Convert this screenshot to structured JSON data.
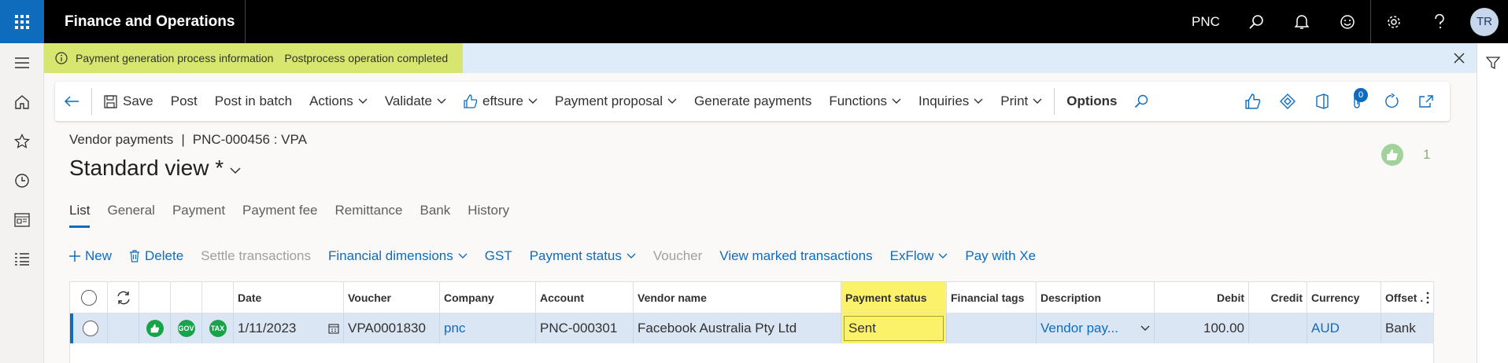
{
  "app": {
    "title": "Finance and Operations",
    "company": "PNC",
    "avatar_initials": "TR"
  },
  "infobar": {
    "label": "Payment generation process information",
    "message": "Postprocess operation completed"
  },
  "actions": {
    "save": "Save",
    "post": "Post",
    "post_in_batch": "Post in batch",
    "actions": "Actions",
    "validate": "Validate",
    "eftsure": "eftsure",
    "payment_proposal": "Payment proposal",
    "generate_payments": "Generate payments",
    "functions": "Functions",
    "inquiries": "Inquiries",
    "print": "Print",
    "options": "Options",
    "attachments_count": "0"
  },
  "page": {
    "breadcrumb_module": "Vendor payments",
    "breadcrumb_sep": "|",
    "breadcrumb_record": "PNC-000456 : VPA",
    "view_title": "Standard view *",
    "likes_count": "1"
  },
  "tabs": [
    "List",
    "General",
    "Payment",
    "Payment fee",
    "Remittance",
    "Bank",
    "History"
  ],
  "gridbar": {
    "new": "New",
    "delete": "Delete",
    "settle": "Settle transactions",
    "financial_dimensions": "Financial dimensions",
    "gst": "GST",
    "payment_status": "Payment status",
    "voucher": "Voucher",
    "view_marked": "View marked transactions",
    "exflow": "ExFlow",
    "pay_with_xe": "Pay with Xe"
  },
  "grid": {
    "columns": {
      "date": "Date",
      "voucher": "Voucher",
      "company": "Company",
      "account": "Account",
      "vendor_name": "Vendor name",
      "payment_status": "Payment status",
      "financial_tags": "Financial tags",
      "description": "Description",
      "debit": "Debit",
      "credit": "Credit",
      "currency": "Currency",
      "offset": "Offset ."
    },
    "row": {
      "badge_gov": "GOV",
      "badge_tax": "TAX",
      "date": "1/11/2023",
      "voucher": "VPA0001830",
      "company": "pnc",
      "account": "PNC-000301",
      "vendor_name": "Facebook Australia Pty Ltd",
      "payment_status": "Sent",
      "financial_tags": "",
      "description": "Vendor pay...",
      "debit": "100.00",
      "credit": "",
      "currency": "AUD",
      "offset": "Bank"
    }
  },
  "colors": {
    "accent": "#0f6cbd",
    "highlight": "#fbf26a",
    "info_highlight": "#d7e66e",
    "status_green": "#17a34a"
  }
}
